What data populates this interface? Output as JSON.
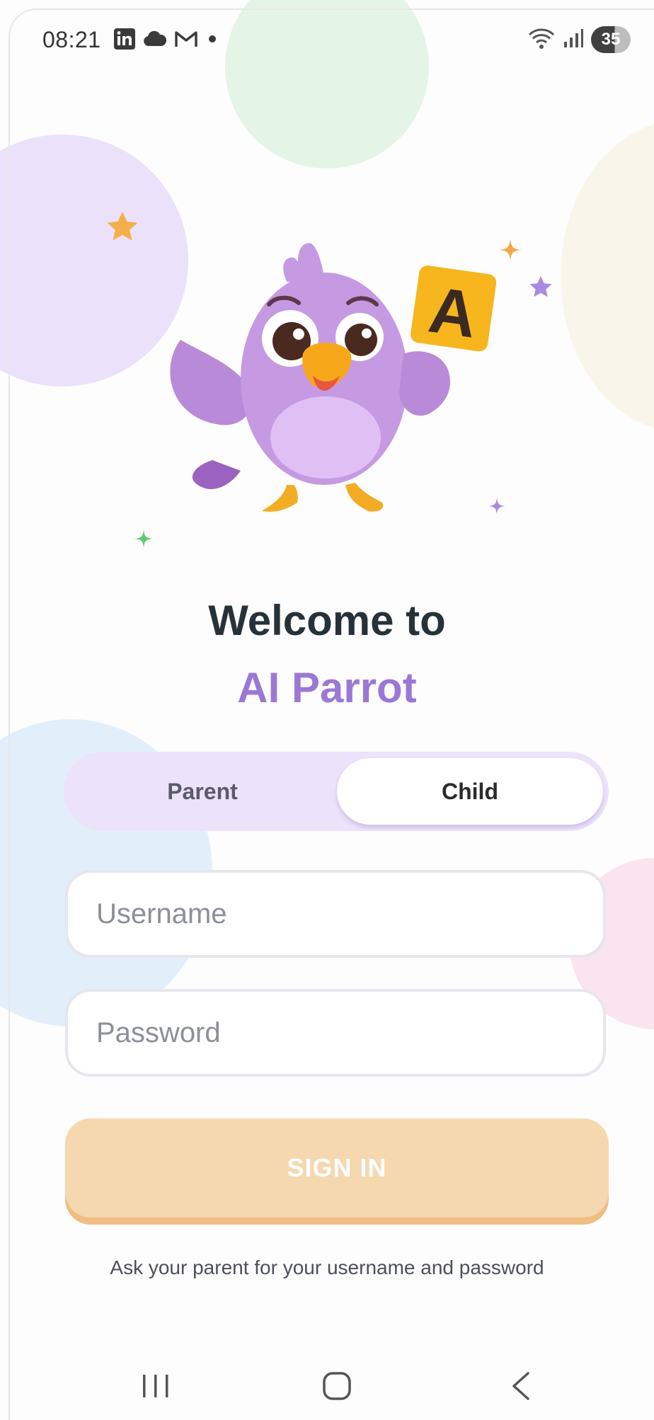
{
  "status_bar": {
    "time": "08:21",
    "notification_icons": [
      "linkedin-icon",
      "cloud-icon",
      "gmail-icon",
      "dot-icon"
    ],
    "system_icons": [
      "wifi-icon",
      "signal-icon"
    ],
    "battery_level": "35"
  },
  "header": {
    "welcome_text": "Welcome to",
    "app_name": "AI Parrot"
  },
  "mascot": {
    "letter_card": "A"
  },
  "role_toggle": {
    "parent_label": "Parent",
    "child_label": "Child",
    "selected": "Child"
  },
  "form": {
    "username_placeholder": "Username",
    "username_value": "",
    "password_placeholder": "Password",
    "password_value": "",
    "signin_label": "SIGN IN",
    "hint": "Ask your parent for your username and password"
  },
  "nav_bar": {
    "icons": [
      "recent-apps-icon",
      "home-icon",
      "back-icon"
    ]
  },
  "colors": {
    "accent_purple": "#9b78d6",
    "heading_dark": "#263238",
    "toggle_bg": "#ece2fa",
    "signin_bg": "#f5d7b0",
    "signin_shadow": "#f2bd82"
  }
}
